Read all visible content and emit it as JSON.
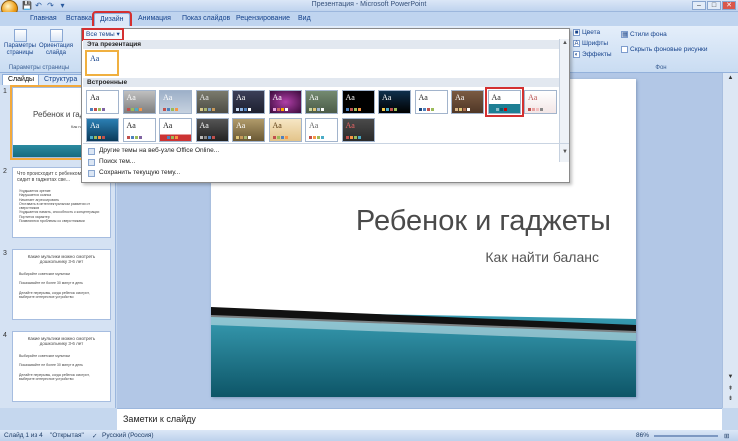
{
  "window": {
    "title": "Презентация - Microsoft PowerPoint",
    "buttons": [
      "–",
      "□",
      "✕"
    ]
  },
  "qat": [
    "💾",
    "↶",
    "↷",
    "▾"
  ],
  "tabs": [
    "Главная",
    "Вставка",
    "Дизайн",
    "Анимация",
    "Показ слайдов",
    "Рецензирование",
    "Вид"
  ],
  "ribbon": {
    "page_setup": "Параметры\nстраницы",
    "orientation": "Ориентация\nслайда",
    "group_label": "Параметры страницы",
    "colors": "Цвета",
    "fonts": "Шрифты",
    "effects": "Эффекты",
    "bg_styles": "Стили фона",
    "hide_bg": "Скрыть фоновые рисунки",
    "bg_group": "Фон"
  },
  "dropdown": {
    "all_themes": "Все темы ▾",
    "this_presentation": "Эта презентация",
    "builtin": "Встроенные",
    "aa": "Aa",
    "menu": [
      "Другие темы на веб-узле Office Online...",
      "Поиск тем...",
      "Сохранить текущую тему..."
    ]
  },
  "pane": {
    "tab_slides": "Слайды",
    "tab_outline": "Структура",
    "close": "✕"
  },
  "thumbs": [
    {
      "num": "1",
      "title": "Ребенок и гадж",
      "sub": "Как на"
    },
    {
      "num": "2",
      "title": "Что происходит с ребенком, когда он сидит в гаджетах све...",
      "bullets": [
        "Ухудшается зрение",
        "Нарушается осанка",
        "Начинает агрессировать",
        "Отставать в интеллектуальном развитии от сверстников",
        "Ухудшается память, способность к концентрации",
        "Портится характер",
        "Появляются проблемы со сверстниками"
      ]
    },
    {
      "num": "3",
      "title": "Какие мультики можно смотреть дошкольнику 3-6 лет",
      "bullets": [
        "Выбирайте советские мультики",
        "Показывайте не более 30 минут в день",
        "Делайте перерывы, когда ребенок смотрит, выберите интересное устройство"
      ]
    },
    {
      "num": "4",
      "title": "Какие мультики можно смотреть дошкольнику 3-6 лет",
      "bullets": [
        "Выбирайте советские мультики",
        "Показывайте не более 30 минут в день",
        "Делайте перерывы, когда ребенок смотрит, выберите интересное устройство"
      ]
    }
  ],
  "slide": {
    "title": "Ребенок и гаджеты",
    "subtitle": "Как найти баланс"
  },
  "notes": "Заметки к слайду",
  "status": {
    "slide": "Слайд 1 из 4",
    "theme": "\"Открытая\"",
    "lang": "Русский (Россия)",
    "zoom": "86%"
  },
  "colors": {
    "accent": "#1e7f94",
    "dark": "#0f5a6c",
    "highlight": "#d43030"
  }
}
